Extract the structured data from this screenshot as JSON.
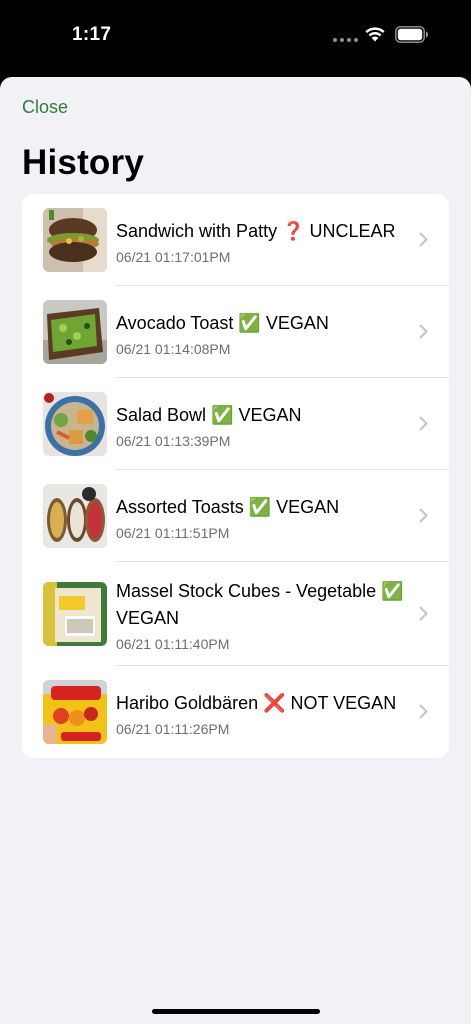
{
  "status_bar": {
    "time": "1:17"
  },
  "sheet": {
    "close_label": "Close",
    "title": "History"
  },
  "history": [
    {
      "title": "Sandwich with Patty ❓ UNCLEAR",
      "date": "06/21 01:17:01PM",
      "thumbnail": "sandwich-photo"
    },
    {
      "title": "Avocado Toast ✅ VEGAN",
      "date": "06/21 01:14:08PM",
      "thumbnail": "avocado-toast-photo"
    },
    {
      "title": "Salad Bowl ✅ VEGAN",
      "date": "06/21 01:13:39PM",
      "thumbnail": "salad-bowl-photo"
    },
    {
      "title": "Assorted Toasts ✅ VEGAN",
      "date": "06/21 01:11:51PM",
      "thumbnail": "assorted-toasts-photo"
    },
    {
      "title": "Massel Stock Cubes - Vegetable ✅ VEGAN",
      "date": "06/21 01:11:40PM",
      "thumbnail": "stock-cubes-photo"
    },
    {
      "title": "Haribo Goldbären ❌ NOT VEGAN",
      "date": "06/21 01:11:26PM",
      "thumbnail": "haribo-photo"
    }
  ],
  "colors": {
    "accent": "#2f7f3c",
    "background": "#f2f1f6",
    "card": "#ffffff",
    "secondary_text": "#6e6e73"
  },
  "icons": {
    "row_disclosure": "chevron-right-icon",
    "wifi": "wifi-icon",
    "battery": "battery-icon"
  }
}
